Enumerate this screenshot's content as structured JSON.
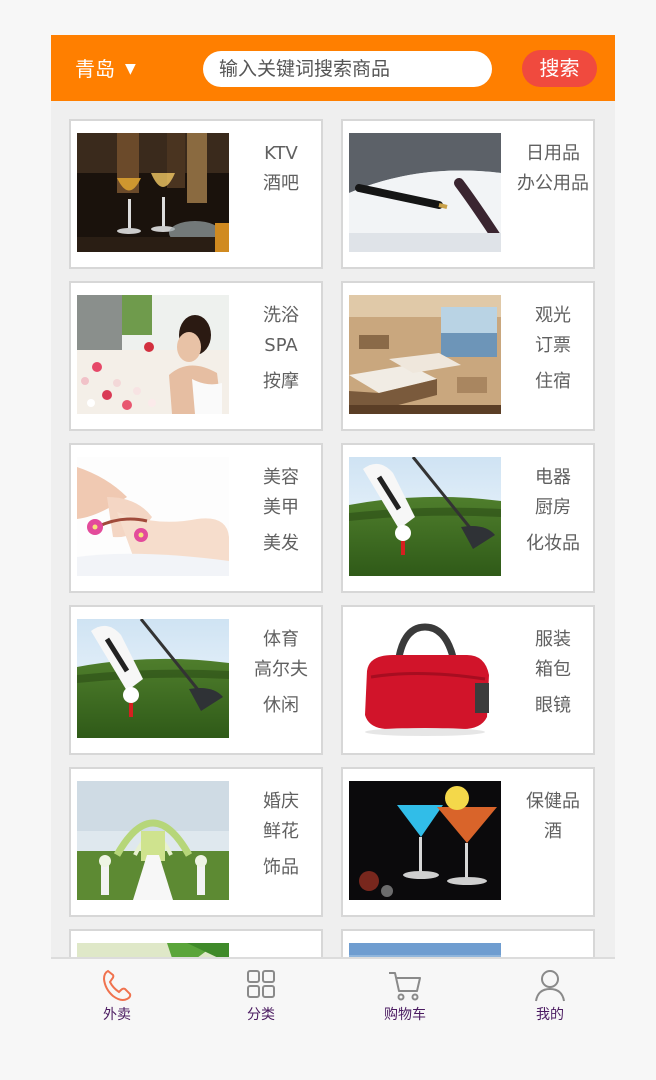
{
  "header": {
    "city": "青岛",
    "city_caret": "▼",
    "search_placeholder": "输入关键词搜索商品",
    "search_button": "搜索"
  },
  "categories": [
    {
      "lines": [
        "KTV",
        "酒吧"
      ],
      "image": "wine-glasses-bar-photo"
    },
    {
      "lines": [
        "日用品",
        "办公用品"
      ],
      "image": "fountain-pen-photo"
    },
    {
      "lines": [
        "洗浴",
        "SPA",
        "按摩"
      ],
      "image": "spa-flower-bath-photo"
    },
    {
      "lines": [
        "观光",
        "订票",
        "住宿"
      ],
      "image": "hotel-room-photo"
    },
    {
      "lines": [
        "美容",
        "美甲",
        "美发"
      ],
      "image": "facial-massage-photo"
    },
    {
      "lines": [
        "电器",
        "厨房",
        "化妆品"
      ],
      "image": "golf-ball-tee-photo"
    },
    {
      "lines": [
        "体育",
        "高尔夫",
        "休闲"
      ],
      "image": "golf-ball-tee-photo"
    },
    {
      "lines": [
        "服装",
        "箱包",
        "眼镜"
      ],
      "image": "red-duffel-bag-photo"
    },
    {
      "lines": [
        "婚庆",
        "鲜花",
        "饰品"
      ],
      "image": "wedding-arch-photo"
    },
    {
      "lines": [
        "保健品",
        "酒"
      ],
      "image": "cocktail-glasses-photo"
    },
    {
      "lines": [],
      "image": "green-leaves-photo"
    },
    {
      "lines": [],
      "image": "blue-sky-photo"
    }
  ],
  "tabbar": [
    {
      "label": "外卖",
      "icon": "phone-icon",
      "active": true
    },
    {
      "label": "分类",
      "icon": "grid-icon",
      "active": false
    },
    {
      "label": "购物车",
      "icon": "cart-icon",
      "active": false
    },
    {
      "label": "我的",
      "icon": "user-icon",
      "active": false
    }
  ],
  "colors": {
    "header_bg": "#ff7f00",
    "search_button_bg": "#f04a3e",
    "tab_active_icon": "#f0724e",
    "tab_label": "#4b1b61"
  }
}
